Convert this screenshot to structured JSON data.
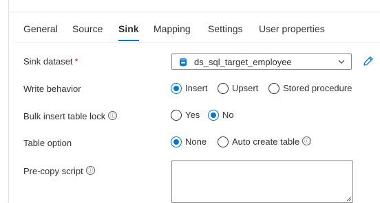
{
  "tabs": [
    {
      "label": "General",
      "active": false
    },
    {
      "label": "Source",
      "active": false
    },
    {
      "label": "Sink",
      "active": true
    },
    {
      "label": "Mapping",
      "active": false
    },
    {
      "label": "Settings",
      "active": false
    },
    {
      "label": "User properties",
      "active": false
    }
  ],
  "fields": {
    "sink_dataset": {
      "label": "Sink dataset",
      "required_marker": "*",
      "value": "ds_sql_target_employee",
      "icon": "sql-database-icon",
      "edit_icon": "pencil-icon"
    },
    "write_behavior": {
      "label": "Write behavior",
      "options": [
        {
          "label": "Insert",
          "checked": true
        },
        {
          "label": "Upsert",
          "checked": false
        },
        {
          "label": "Stored procedure",
          "checked": false
        }
      ]
    },
    "bulk_insert_table_lock": {
      "label": "Bulk insert table lock",
      "info_icon": "ⓘ",
      "options": [
        {
          "label": "Yes",
          "checked": false
        },
        {
          "label": "No",
          "checked": true
        }
      ]
    },
    "table_option": {
      "label": "Table option",
      "options": [
        {
          "label": "None",
          "checked": true
        },
        {
          "label": "Auto create table",
          "checked": false,
          "info_icon": "ⓘ"
        }
      ]
    },
    "pre_copy_script": {
      "label": "Pre-copy script",
      "info_icon": "ⓘ",
      "value": ""
    }
  },
  "colors": {
    "accent": "#0078d4",
    "required": "#a4262c",
    "text": "#323130"
  }
}
